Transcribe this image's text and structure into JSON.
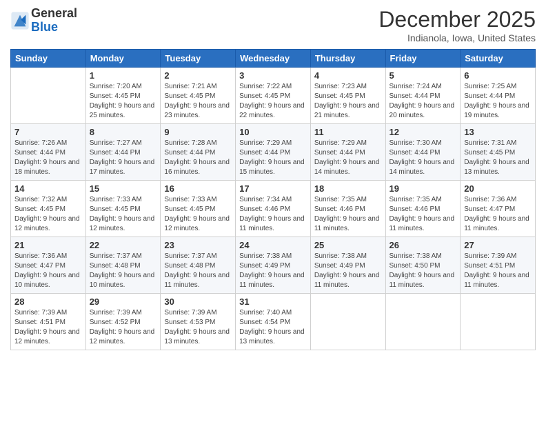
{
  "logo": {
    "general": "General",
    "blue": "Blue"
  },
  "title": "December 2025",
  "location": "Indianola, Iowa, United States",
  "days_of_week": [
    "Sunday",
    "Monday",
    "Tuesday",
    "Wednesday",
    "Thursday",
    "Friday",
    "Saturday"
  ],
  "weeks": [
    [
      {
        "day": null,
        "info": null
      },
      {
        "day": "1",
        "sunrise": "7:20 AM",
        "sunset": "4:45 PM",
        "daylight": "9 hours and 25 minutes."
      },
      {
        "day": "2",
        "sunrise": "7:21 AM",
        "sunset": "4:45 PM",
        "daylight": "9 hours and 23 minutes."
      },
      {
        "day": "3",
        "sunrise": "7:22 AM",
        "sunset": "4:45 PM",
        "daylight": "9 hours and 22 minutes."
      },
      {
        "day": "4",
        "sunrise": "7:23 AM",
        "sunset": "4:45 PM",
        "daylight": "9 hours and 21 minutes."
      },
      {
        "day": "5",
        "sunrise": "7:24 AM",
        "sunset": "4:44 PM",
        "daylight": "9 hours and 20 minutes."
      },
      {
        "day": "6",
        "sunrise": "7:25 AM",
        "sunset": "4:44 PM",
        "daylight": "9 hours and 19 minutes."
      }
    ],
    [
      {
        "day": "7",
        "sunrise": "7:26 AM",
        "sunset": "4:44 PM",
        "daylight": "9 hours and 18 minutes."
      },
      {
        "day": "8",
        "sunrise": "7:27 AM",
        "sunset": "4:44 PM",
        "daylight": "9 hours and 17 minutes."
      },
      {
        "day": "9",
        "sunrise": "7:28 AM",
        "sunset": "4:44 PM",
        "daylight": "9 hours and 16 minutes."
      },
      {
        "day": "10",
        "sunrise": "7:29 AM",
        "sunset": "4:44 PM",
        "daylight": "9 hours and 15 minutes."
      },
      {
        "day": "11",
        "sunrise": "7:29 AM",
        "sunset": "4:44 PM",
        "daylight": "9 hours and 14 minutes."
      },
      {
        "day": "12",
        "sunrise": "7:30 AM",
        "sunset": "4:44 PM",
        "daylight": "9 hours and 14 minutes."
      },
      {
        "day": "13",
        "sunrise": "7:31 AM",
        "sunset": "4:45 PM",
        "daylight": "9 hours and 13 minutes."
      }
    ],
    [
      {
        "day": "14",
        "sunrise": "7:32 AM",
        "sunset": "4:45 PM",
        "daylight": "9 hours and 12 minutes."
      },
      {
        "day": "15",
        "sunrise": "7:33 AM",
        "sunset": "4:45 PM",
        "daylight": "9 hours and 12 minutes."
      },
      {
        "day": "16",
        "sunrise": "7:33 AM",
        "sunset": "4:45 PM",
        "daylight": "9 hours and 12 minutes."
      },
      {
        "day": "17",
        "sunrise": "7:34 AM",
        "sunset": "4:46 PM",
        "daylight": "9 hours and 11 minutes."
      },
      {
        "day": "18",
        "sunrise": "7:35 AM",
        "sunset": "4:46 PM",
        "daylight": "9 hours and 11 minutes."
      },
      {
        "day": "19",
        "sunrise": "7:35 AM",
        "sunset": "4:46 PM",
        "daylight": "9 hours and 11 minutes."
      },
      {
        "day": "20",
        "sunrise": "7:36 AM",
        "sunset": "4:47 PM",
        "daylight": "9 hours and 11 minutes."
      }
    ],
    [
      {
        "day": "21",
        "sunrise": "7:36 AM",
        "sunset": "4:47 PM",
        "daylight": "9 hours and 10 minutes."
      },
      {
        "day": "22",
        "sunrise": "7:37 AM",
        "sunset": "4:48 PM",
        "daylight": "9 hours and 10 minutes."
      },
      {
        "day": "23",
        "sunrise": "7:37 AM",
        "sunset": "4:48 PM",
        "daylight": "9 hours and 11 minutes."
      },
      {
        "day": "24",
        "sunrise": "7:38 AM",
        "sunset": "4:49 PM",
        "daylight": "9 hours and 11 minutes."
      },
      {
        "day": "25",
        "sunrise": "7:38 AM",
        "sunset": "4:49 PM",
        "daylight": "9 hours and 11 minutes."
      },
      {
        "day": "26",
        "sunrise": "7:38 AM",
        "sunset": "4:50 PM",
        "daylight": "9 hours and 11 minutes."
      },
      {
        "day": "27",
        "sunrise": "7:39 AM",
        "sunset": "4:51 PM",
        "daylight": "9 hours and 11 minutes."
      }
    ],
    [
      {
        "day": "28",
        "sunrise": "7:39 AM",
        "sunset": "4:51 PM",
        "daylight": "9 hours and 12 minutes."
      },
      {
        "day": "29",
        "sunrise": "7:39 AM",
        "sunset": "4:52 PM",
        "daylight": "9 hours and 12 minutes."
      },
      {
        "day": "30",
        "sunrise": "7:39 AM",
        "sunset": "4:53 PM",
        "daylight": "9 hours and 13 minutes."
      },
      {
        "day": "31",
        "sunrise": "7:40 AM",
        "sunset": "4:54 PM",
        "daylight": "9 hours and 13 minutes."
      },
      null,
      null,
      null
    ]
  ]
}
